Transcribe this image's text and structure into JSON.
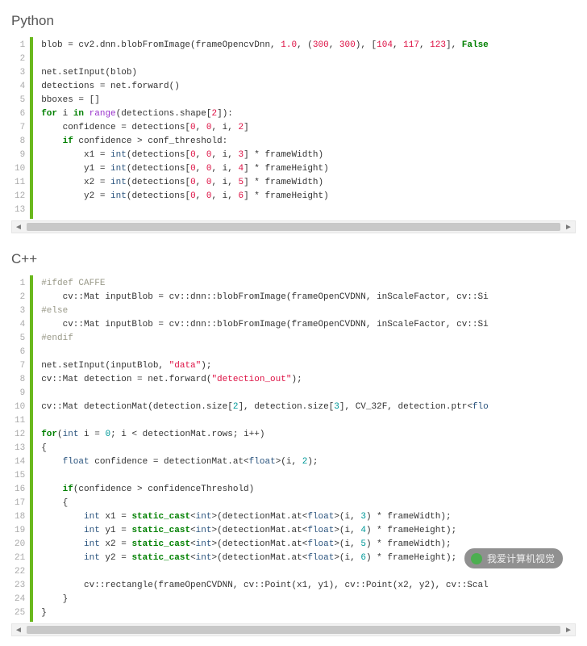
{
  "sections": {
    "python": {
      "title": "Python"
    },
    "cpp": {
      "title": "C++"
    }
  },
  "py": {
    "l1": "blob = cv2.dnn.blobFromImage(frameOpencvDnn, ",
    "l1n1": "1.0",
    "l1a": ", (",
    "l1n2": "300",
    "l1b": ", ",
    "l1n3": "300",
    "l1c": "), [",
    "l1n4": "104",
    "l1d": ", ",
    "l1n5": "117",
    "l1e": ", ",
    "l1n6": "123",
    "l1f": "], ",
    "l1g": "False",
    "l3": "net.setInput(blob)",
    "l4": "detections = net.forward()",
    "l5": "bboxes = []",
    "l6a": "for",
    "l6b": " i ",
    "l6c": "in",
    "l6d": " ",
    "l6e": "range",
    "l6f": "(detections.shape[",
    "l6n": "2",
    "l6g": "]):",
    "l7a": "    confidence = detections[",
    "l7n1": "0",
    "l7b": ", ",
    "l7n2": "0",
    "l7c": ", i, ",
    "l7n3": "2",
    "l7d": "]",
    "l8a": "    ",
    "l8b": "if",
    "l8c": " confidence > conf_threshold:",
    "l9a": "        x1 = ",
    "l9b": "int",
    "l9c": "(detections[",
    "l9n1": "0",
    "l9d": ", ",
    "l9n2": "0",
    "l9e": ", i, ",
    "l9n3": "3",
    "l9f": "] * frameWidth)",
    "l10a": "        y1 = ",
    "l10b": "int",
    "l10c": "(detections[",
    "l10n1": "0",
    "l10d": ", ",
    "l10n2": "0",
    "l10e": ", i, ",
    "l10n3": "4",
    "l10f": "] * frameHeight)",
    "l11a": "        x2 = ",
    "l11b": "int",
    "l11c": "(detections[",
    "l11n1": "0",
    "l11d": ", ",
    "l11n2": "0",
    "l11e": ", i, ",
    "l11n3": "5",
    "l11f": "] * frameWidth)",
    "l12a": "        y2 = ",
    "l12b": "int",
    "l12c": "(detections[",
    "l12n1": "0",
    "l12d": ", ",
    "l12n2": "0",
    "l12e": ", i, ",
    "l12n3": "6",
    "l12f": "] * frameHeight)"
  },
  "cpp": {
    "l1": "#ifdef CAFFE",
    "l2": "    cv::Mat inputBlob = cv::dnn::blobFromImage(frameOpenCVDNN, inScaleFactor, cv::Si",
    "l3": "#else",
    "l4": "    cv::Mat inputBlob = cv::dnn::blobFromImage(frameOpenCVDNN, inScaleFactor, cv::Si",
    "l5": "#endif",
    "l7a": "net.setInput(inputBlob, ",
    "l7s": "\"data\"",
    "l7b": ");",
    "l8a": "cv::Mat detection = net.forward(",
    "l8s": "\"detection_out\"",
    "l8b": ");",
    "l10a": "cv::Mat detectionMat(detection.size[",
    "l10n1": "2",
    "l10b": "], detection.size[",
    "l10n2": "3",
    "l10c": "], CV_32F, detection.ptr<",
    "l10t": "flo",
    "l12a": "for",
    "l12b": "(",
    "l12c": "int",
    "l12d": " i = ",
    "l12n": "0",
    "l12e": "; i < detectionMat.rows; i++)",
    "l13": "{",
    "l14a": "    ",
    "l14b": "float",
    "l14c": " confidence = detectionMat.at<",
    "l14d": "float",
    "l14e": ">(i, ",
    "l14n": "2",
    "l14f": ");",
    "l16a": "    ",
    "l16b": "if",
    "l16c": "(confidence > confidenceThreshold)",
    "l17": "    {",
    "l18a": "        ",
    "l18b": "int",
    "l18c": " x1 = ",
    "l18d": "static_cast",
    "l18e": "<",
    "l18f": "int",
    "l18g": ">(detectionMat.at<",
    "l18h": "float",
    "l18i": ">(i, ",
    "l18n": "3",
    "l18j": ") * frameWidth);",
    "l19a": "        ",
    "l19b": "int",
    "l19c": " y1 = ",
    "l19d": "static_cast",
    "l19e": "<",
    "l19f": "int",
    "l19g": ">(detectionMat.at<",
    "l19h": "float",
    "l19i": ">(i, ",
    "l19n": "4",
    "l19j": ") * frameHeight);",
    "l20a": "        ",
    "l20b": "int",
    "l20c": " x2 = ",
    "l20d": "static_cast",
    "l20e": "<",
    "l20f": "int",
    "l20g": ">(detectionMat.at<",
    "l20h": "float",
    "l20i": ">(i, ",
    "l20n": "5",
    "l20j": ") * frameWidth);",
    "l21a": "        ",
    "l21b": "int",
    "l21c": " y2 = ",
    "l21d": "static_cast",
    "l21e": "<",
    "l21f": "int",
    "l21g": ">(detectionMat.at<",
    "l21h": "float",
    "l21i": ">(i, ",
    "l21n": "6",
    "l21j": ") * frameHeight);",
    "l23": "        cv::rectangle(frameOpenCVDNN, cv::Point(x1, y1), cv::Point(x2, y2), cv::Scal",
    "l24": "    }",
    "l25": "}"
  },
  "gutter": {
    "py": [
      "1",
      "2",
      "3",
      "4",
      "5",
      "6",
      "7",
      "8",
      "9",
      "10",
      "11",
      "12",
      "13"
    ],
    "cpp": [
      "1",
      "2",
      "3",
      "4",
      "5",
      "6",
      "7",
      "8",
      "9",
      "10",
      "11",
      "12",
      "13",
      "14",
      "15",
      "16",
      "17",
      "18",
      "19",
      "20",
      "21",
      "22",
      "23",
      "24",
      "25"
    ]
  },
  "watermark": {
    "text": "我爱计算机视觉"
  },
  "scroll": {
    "left": "◄",
    "right": "►"
  }
}
